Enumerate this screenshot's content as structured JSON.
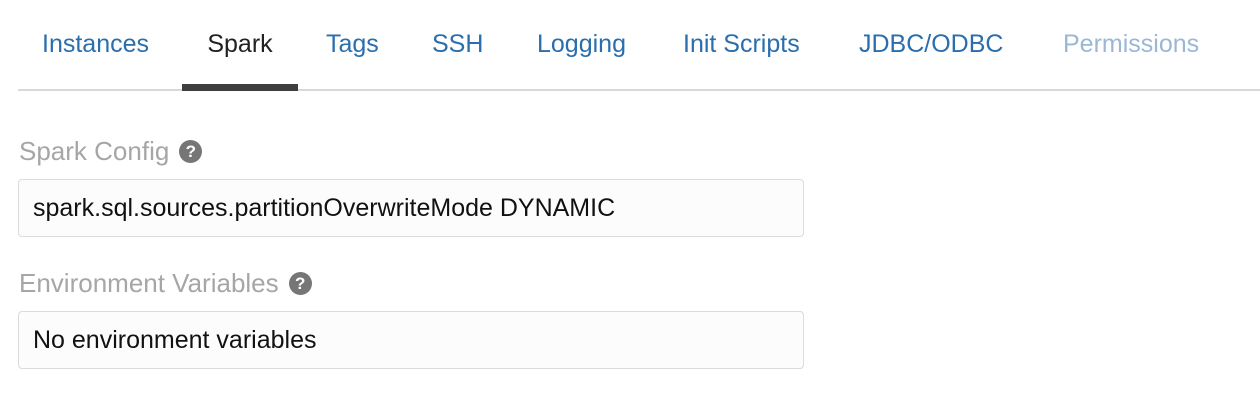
{
  "tabs": [
    {
      "label": "Instances",
      "state": "normal"
    },
    {
      "label": "Spark",
      "state": "active"
    },
    {
      "label": "Tags",
      "state": "normal"
    },
    {
      "label": "SSH",
      "state": "normal"
    },
    {
      "label": "Logging",
      "state": "normal"
    },
    {
      "label": "Init Scripts",
      "state": "normal"
    },
    {
      "label": "JDBC/ODBC",
      "state": "normal"
    },
    {
      "label": "Permissions",
      "state": "disabled"
    }
  ],
  "spark_config": {
    "label": "Spark Config",
    "help_icon": "question-circle-icon",
    "value": "spark.sql.sources.partitionOverwriteMode DYNAMIC"
  },
  "env_vars": {
    "label": "Environment Variables",
    "help_icon": "question-circle-icon",
    "value": "No environment variables"
  },
  "colors": {
    "tab_link": "#2a6ead",
    "tab_active": "#222222",
    "tab_disabled": "#9bb7d6",
    "label_gray": "#a6a6a6"
  }
}
